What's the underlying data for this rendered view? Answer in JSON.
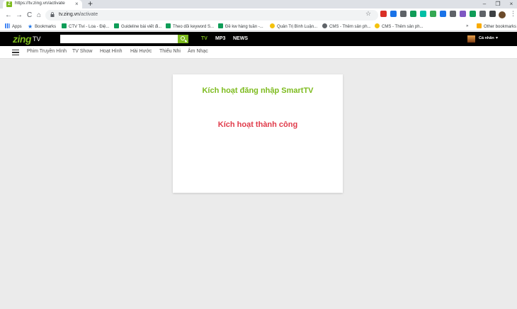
{
  "browser": {
    "tab": {
      "favicon_letter": "Z",
      "title": "https://tv.zing.vn/activate",
      "close": "×"
    },
    "new_tab": "+",
    "window_controls": {
      "minimize": "–",
      "maximize": "❐",
      "close": "×"
    },
    "nav": {
      "back": "←",
      "forward": "→",
      "reload": "C",
      "home": "⌂"
    },
    "url": {
      "host": "tv.zing.vn",
      "path": "/activate"
    },
    "bookmark_star": "☆",
    "menu_dots": "⋮",
    "extension_colors": [
      "#d93025",
      "#1a73e8",
      "#5f6368",
      "#0f9d58",
      "#00bfa5",
      "#34a853",
      "#1a73e8",
      "#5f6368",
      "#7e57c2",
      "#0f9d58",
      "#5f6368",
      "#3c4043"
    ]
  },
  "bookmarks": {
    "items": [
      {
        "label": "Apps",
        "icon": "apps-grid-icon"
      },
      {
        "label": "Bookmarks",
        "icon": "star-icon"
      },
      {
        "label": "CTV Tivi - Loa - Điệ...",
        "icon": "sheets-icon"
      },
      {
        "label": "Guideline bài viết đi...",
        "icon": "sheets-icon"
      },
      {
        "label": "Theo dõi keyword S...",
        "icon": "sheets-icon"
      },
      {
        "label": "Đề kw hàng tuần -...",
        "icon": "sheets-icon"
      },
      {
        "label": "Quản Trị Bình Luận...",
        "icon": "yellow-badge-icon"
      },
      {
        "label": "CMS - Thêm sản ph...",
        "icon": "globe-icon"
      },
      {
        "label": "CMS - Thêm sản ph...",
        "icon": "yellow-badge-icon"
      }
    ],
    "overflow": "»",
    "other": "Other bookmarks"
  },
  "zing": {
    "logo_main": "zing",
    "logo_sub": "TV",
    "search_placeholder": "",
    "nav": [
      "TV",
      "MP3",
      "NEWS"
    ],
    "account_label": "Cá nhân",
    "account_caret": "▾",
    "accent": "#7dbb1e"
  },
  "subnav": {
    "items": [
      "Phim Truyền Hình",
      "TV Show",
      "Hoạt Hình",
      "Hài Hước",
      "Thiếu Nhi",
      "Âm Nhạc"
    ]
  },
  "card": {
    "title": "Kích hoạt đăng nhập SmartTV",
    "message": "Kích hoạt thành công",
    "title_color": "#7dbb1e",
    "message_color": "#e03b4a"
  }
}
